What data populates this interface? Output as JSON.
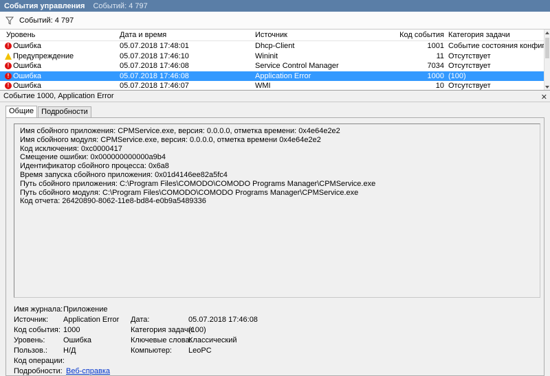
{
  "titlebar": {
    "title": "События управления",
    "count": "Событий: 4 797"
  },
  "filterbar": {
    "count": "Событий: 4 797"
  },
  "grid": {
    "headers": {
      "level": "Уровень",
      "date": "Дата и время",
      "source": "Источник",
      "code": "Код события",
      "category": "Категория задачи"
    },
    "rows": [
      {
        "level": "Ошибка",
        "type": "error",
        "date": "05.07.2018 17:48:01",
        "source": "Dhcp-Client",
        "code": "1001",
        "category": "Событие состояния конфигур..."
      },
      {
        "level": "Предупреждение",
        "type": "warning",
        "date": "05.07.2018 17:46:10",
        "source": "Wininit",
        "code": "11",
        "category": "Отсутствует"
      },
      {
        "level": "Ошибка",
        "type": "error",
        "date": "05.07.2018 17:46:08",
        "source": "Service Control Manager",
        "code": "7034",
        "category": "Отсутствует"
      },
      {
        "level": "Ошибка",
        "type": "error",
        "date": "05.07.2018 17:46:08",
        "source": "Application Error",
        "code": "1000",
        "category": "(100)"
      },
      {
        "level": "Ошибка",
        "type": "error",
        "date": "05.07.2018 17:46:07",
        "source": "WMI",
        "code": "10",
        "category": "Отсутствует"
      }
    ]
  },
  "detail": {
    "title": "Событие 1000, Application Error",
    "tabs": [
      "Общие",
      "Подробности"
    ],
    "message": [
      "Имя сбойного приложения: CPMService.exe, версия: 0.0.0.0, отметка времени: 0x4e64e2e2",
      "Имя сбойного модуля: CPMService.exe, версия: 0.0.0.0, отметка времени 0x4e64e2e2",
      "Код исключения: 0xc0000417",
      "Смещение ошибки: 0x000000000000a9b4",
      "Идентификатор сбойного процесса: 0x6a8",
      "Время запуска сбойного приложения: 0x01d4146ee82a5fc4",
      "Путь сбойного приложения: C:\\Program Files\\COMODO\\COMODO Programs Manager\\CPMService.exe",
      "Путь сбойного модуля: C:\\Program Files\\COMODO\\COMODO Programs Manager\\CPMService.exe",
      "Код отчета: 26420890-8062-11e8-bd84-e0b9a5489336"
    ],
    "props": {
      "log_label": "Имя журнала:",
      "log_value": "Приложение",
      "source_label": "Источник:",
      "source_value": "Application Error",
      "date_label": "Дата:",
      "date_value": "05.07.2018 17:46:08",
      "code_label": "Код события:",
      "code_value": "1000",
      "category_label": "Категория задачи:",
      "category_value": "(100)",
      "level_label": "Уровень:",
      "level_value": "Ошибка",
      "keywords_label": "Ключевые слова:",
      "keywords_value": "Классический",
      "user_label": "Пользов.:",
      "user_value": "Н/Д",
      "computer_label": "Компьютер:",
      "computer_value": "LeoPC",
      "opcode_label": "Код операции:",
      "more_label": "Подробности:",
      "more_link": "Веб-справка"
    }
  },
  "colors": {
    "titlebar": "#5a7ea7",
    "selected": "#3399ff",
    "link": "#0033cc"
  }
}
